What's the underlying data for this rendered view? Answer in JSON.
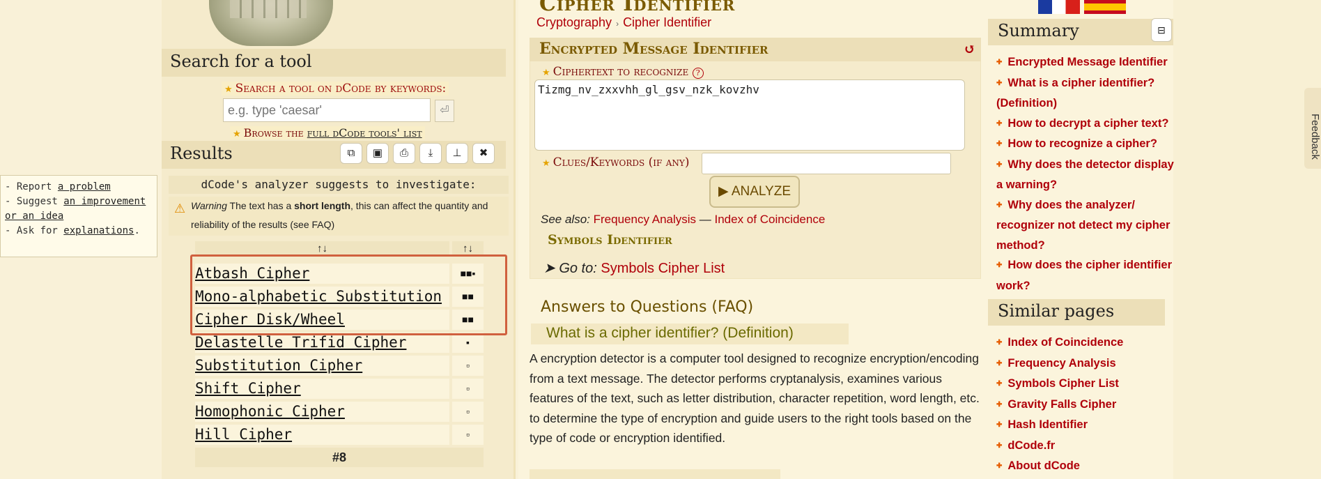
{
  "left": {
    "search_title": "Search for a tool",
    "search_label": "Search a tool on dCode by keywords:",
    "search_placeholder": "e.g. type 'caesar'",
    "search_go_icon": "⏎",
    "browse_prefix": "Browse the",
    "browse_link": "full dCode tools' list",
    "results_title": "Results",
    "toolbar_icons": [
      "copy-icon",
      "save-icon",
      "print-icon",
      "download-icon",
      "pin-icon",
      "close-icon"
    ],
    "toolbar_glyphs": [
      "⧉",
      "▣",
      "⎙",
      "⤓",
      "⊥",
      "✖"
    ],
    "suggest": "dCode's analyzer suggests to investigate:",
    "warning": {
      "lead": "Warning",
      "text_a": "The text has a",
      "strong": "short length",
      "text_b": ", this can affect the quantity and reliability of the results (see FAQ)"
    },
    "sort_label": "↑↓",
    "results": [
      {
        "name": "Atbash Cipher",
        "score": "■■▪"
      },
      {
        "name": "Mono-alphabetic Substitution",
        "score": "■■"
      },
      {
        "name": "Cipher Disk/Wheel",
        "score": "■■"
      },
      {
        "name": "Delastelle Trifid Cipher",
        "score": "▪"
      },
      {
        "name": "Substitution Cipher",
        "score": "▫"
      },
      {
        "name": "Shift Cipher",
        "score": "▫"
      },
      {
        "name": "Homophonic Cipher",
        "score": "▫"
      },
      {
        "name": "Hill Cipher",
        "score": "▫"
      }
    ],
    "results_total": "#8"
  },
  "feedback_box": {
    "line1_prefix": "- Report",
    "line1_link": "a problem",
    "line2_prefix": "- Suggest",
    "line2_link": "an improvement or an idea",
    "line3_prefix": "- Ask for",
    "line3_link": "explanations",
    "line3_suffix": "."
  },
  "main": {
    "title": "Cipher Identifier",
    "breadcrumb": [
      "Cryptography",
      "Cipher Identifier"
    ],
    "breadcrumb_sep": "›",
    "tool_title": "Encrypted Message Identifier",
    "reload_icon": "↺",
    "ciphertext_label": "Ciphertext to recognize",
    "help_icon": "?",
    "ciphertext_value": "Tizmg_nv_zxxvhh_gl_gsv_nzk_kovzhv",
    "clues_label": "Clues/Keywords (if any)",
    "clues_value": "",
    "analyze_label": "▶ ANALYZE",
    "see_also_label": "See also:",
    "see_also_links": [
      "Frequency Analysis",
      "Index of Coincidence"
    ],
    "see_also_sep": "—",
    "symbols_title": "Symbols Identifier",
    "goto_label": "➤ Go to:",
    "goto_link": "Symbols Cipher List",
    "faq_title": "Answers to Questions (FAQ)",
    "faq_q1": "What is a cipher identifier? (Definition)",
    "faq_a1": "A encryption detector is a computer tool designed to recognize encryption/encoding from a text message. The detector performs cryptanalysis, examines various features of the text, such as letter distribution, character repetition, word length, etc. to determine the type of encryption and guide users to the right tools based on the type of code or encryption identified."
  },
  "right": {
    "summary_title": "Summary",
    "collapse_icon": "⊟",
    "summary_items": [
      "Encrypted Message Identifier",
      "What is a cipher identifier? (Definition)",
      "How to decrypt a cipher text?",
      "How to recognize a cipher?",
      "Why does the detector display a warning?",
      "Why does the analyzer/ recognizer not detect my cipher method?",
      "How does the cipher identifier work?"
    ],
    "similar_title": "Similar pages",
    "similar_items": [
      "Index of Coincidence",
      "Frequency Analysis",
      "Symbols Cipher List",
      "Gravity Falls Cipher",
      "Hash Identifier",
      "dCode.fr",
      "About dCode"
    ],
    "feedback_tab": "Feedback"
  },
  "colors": {
    "link_red": "#b0000a",
    "title_gold": "#7a5a00",
    "highlight_box": "#d0603e"
  }
}
